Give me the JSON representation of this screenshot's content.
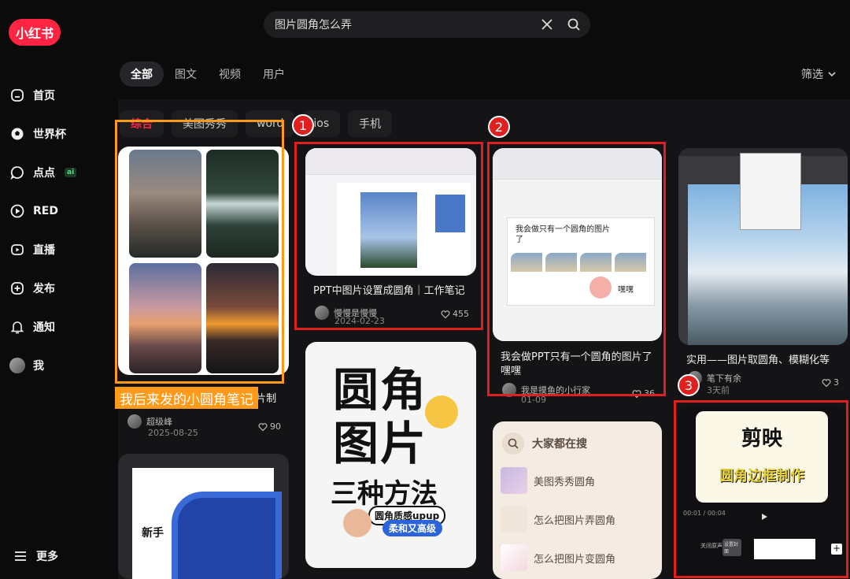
{
  "brand": {
    "logo": "小红书",
    "color": "#ff2442"
  },
  "sidebar": {
    "items": [
      {
        "label": "首页",
        "icon": "home-icon"
      },
      {
        "label": "世界杯",
        "icon": "soccer-icon"
      },
      {
        "label": "点点",
        "icon": "chat-bubble-icon",
        "badge": "ai"
      },
      {
        "label": "RED",
        "icon": "play-circle-icon"
      },
      {
        "label": "直播",
        "icon": "live-icon"
      },
      {
        "label": "发布",
        "icon": "plus-square-icon"
      },
      {
        "label": "通知",
        "icon": "bell-icon"
      },
      {
        "label": "我",
        "icon": "avatar"
      }
    ],
    "more": "更多"
  },
  "search": {
    "query": "图片圆角怎么弄"
  },
  "tabs": [
    "全部",
    "图文",
    "视频",
    "用户"
  ],
  "filter": "筛选",
  "chips": [
    "综合",
    "美图秀秀",
    "word",
    "ios",
    "手机"
  ],
  "cards": {
    "c1": {
      "title": "被我用iOS隐藏的圆角边框图片制作方法",
      "author": "超级峰",
      "date": "2025-08-25",
      "likes": "90"
    },
    "c2": {
      "title": "PPT中图片设置成圆角｜工作笔记",
      "author": "慢慢是慢慢",
      "date": "2024-02-23",
      "likes": "455"
    },
    "c3": {
      "title": "我会做PPT只有一个圆角的图片了嘿嘿",
      "author": "我是摸鱼的小行家",
      "date": "01-09",
      "likes": "36",
      "slide_text": "我会做只有一个圆角的图片了",
      "sticker_text": "嘿嘿"
    },
    "c4": {
      "title": "实用——图片取圆角、模糊化等",
      "author": "笔下有余",
      "date": "3天前",
      "likes": "3"
    },
    "c5": {
      "cover_line1": "圆角",
      "cover_line2": "图片",
      "cover_line3": "三种方法",
      "tag1": "圆角质感upup",
      "tag2": "柔和又高级"
    },
    "c6": {
      "cover_title": "剪映",
      "cover_sub": "圆角边框制作",
      "time": "00:01 / 00:04",
      "mute": "关闭原声",
      "setcover": "设置封面"
    },
    "c7": {
      "cover_text": "新手"
    }
  },
  "suggestions": {
    "title": "大家都在搜",
    "items": [
      "美图秀秀圆角",
      "怎么把图片弄圆角",
      "怎么把图片变圆角"
    ]
  },
  "annotations": {
    "label": "我后来发的小圆角笔记",
    "numbers": [
      "1",
      "2",
      "3"
    ]
  }
}
